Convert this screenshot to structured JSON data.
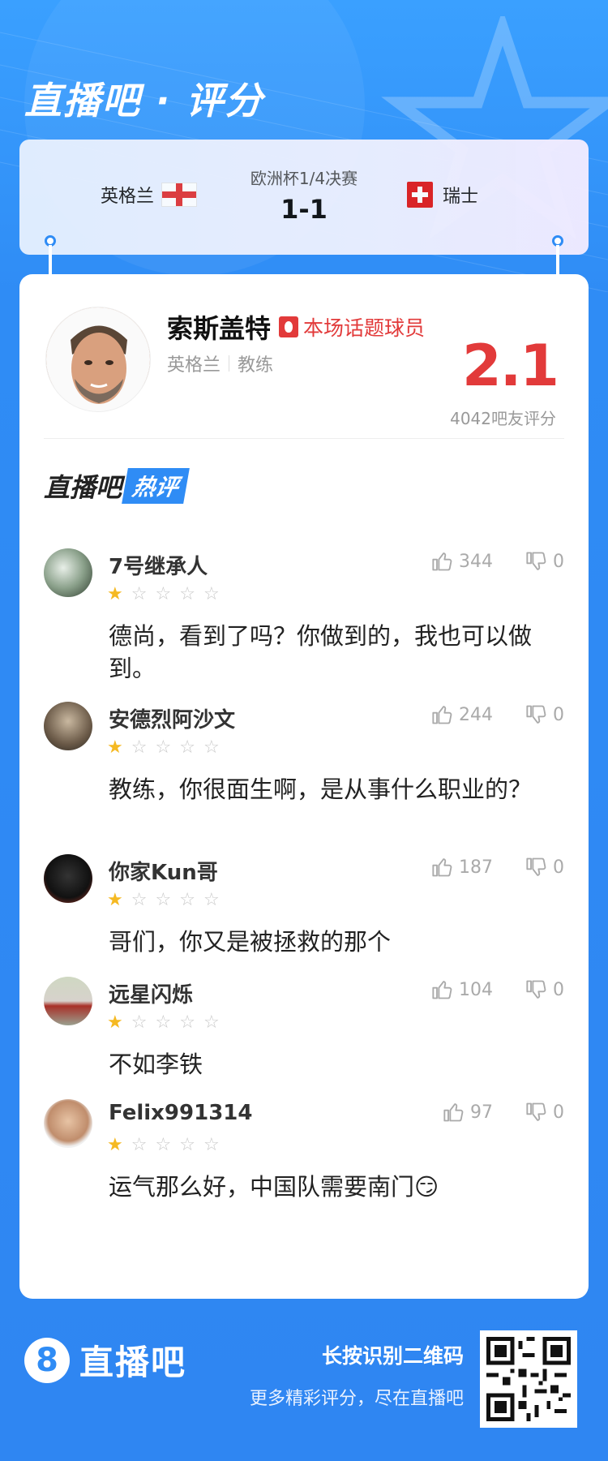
{
  "app": {
    "title": "直播吧 · 评分"
  },
  "match": {
    "home_team": "英格兰",
    "away_team": "瑞士",
    "stage": "欧洲杯1/4决赛",
    "score": "1-1"
  },
  "subject": {
    "name": "索斯盖特",
    "badge": "本场话题球员",
    "team": "英格兰",
    "role": "教练",
    "rating": "2.1",
    "rating_count": "4042吧友评分"
  },
  "section": {
    "title_main": "直播吧",
    "title_tag": "热评"
  },
  "comments": [
    {
      "user": "7号继承人",
      "stars": 1,
      "likes": "344",
      "dislikes": "0",
      "text": "德尚，看到了吗？你做到的，我也可以做到。"
    },
    {
      "user": "安德烈阿沙文",
      "stars": 1,
      "likes": "244",
      "dislikes": "0",
      "text": "教练，你很面生啊，是从事什么职业的？"
    },
    {
      "user": "你家Kun哥",
      "stars": 1,
      "likes": "187",
      "dislikes": "0",
      "text": "哥们，你又是被拯救的那个"
    },
    {
      "user": "远星闪烁",
      "stars": 1,
      "likes": "104",
      "dislikes": "0",
      "text": "不如李铁"
    },
    {
      "user": "Felix991314",
      "stars": 1,
      "likes": "97",
      "dislikes": "0",
      "text": "运气那么好，中国队需要南门😏"
    }
  ],
  "footer": {
    "logo_mark": "8",
    "logo_text": "直播吧",
    "qr_title": "长按识别二维码",
    "qr_sub": "更多精彩评分，尽在直播吧"
  },
  "colors": {
    "brand_blue": "#2f8cf5",
    "rating_red": "#e23a3a",
    "star_gold": "#f5b922"
  }
}
